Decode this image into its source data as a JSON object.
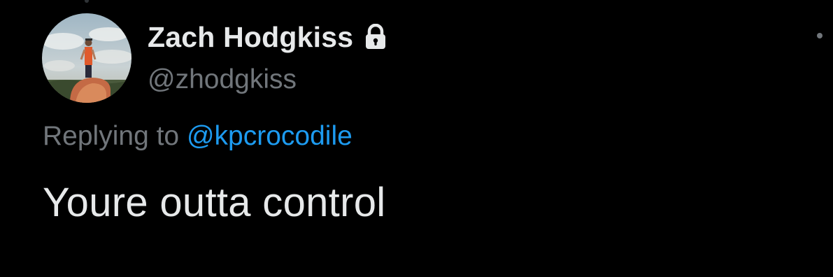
{
  "author": {
    "display_name": "Zach Hodgkiss",
    "handle": "@zhodgkiss",
    "protected_icon": "lock-icon",
    "avatar_icon": "profile-photo"
  },
  "reply": {
    "prefix": "Replying to",
    "to_handle": "@kpcrocodile"
  },
  "tweet": {
    "text": "Youre outta control"
  },
  "menu": {
    "icon": "more-dots-icon"
  },
  "colors": {
    "background": "#000000",
    "primary_text": "#e7e9ea",
    "secondary_text": "#71767b",
    "link": "#1d9bf0"
  }
}
